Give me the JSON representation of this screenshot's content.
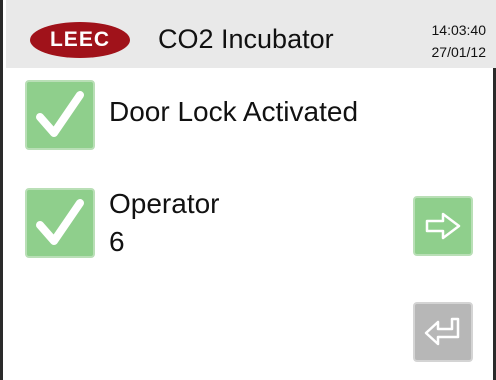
{
  "header": {
    "logo_text": "LEEC",
    "logo_color": "#a0121a",
    "title": "CO2 Incubator",
    "time": "14:03:40",
    "date": "27/01/12"
  },
  "status": {
    "door_lock": {
      "icon": "checkmark-icon",
      "label": "Door Lock Activated",
      "state": "ok"
    },
    "operator": {
      "icon": "checkmark-icon",
      "label": "Operator",
      "value": "6",
      "state": "ok"
    }
  },
  "controls": {
    "next_icon": "arrow-right-icon",
    "enter_icon": "enter-return-icon"
  },
  "colors": {
    "accent_green": "#8fcf8c",
    "disabled_grey": "#b7b7b7",
    "header_bg": "#e9e9e9"
  }
}
